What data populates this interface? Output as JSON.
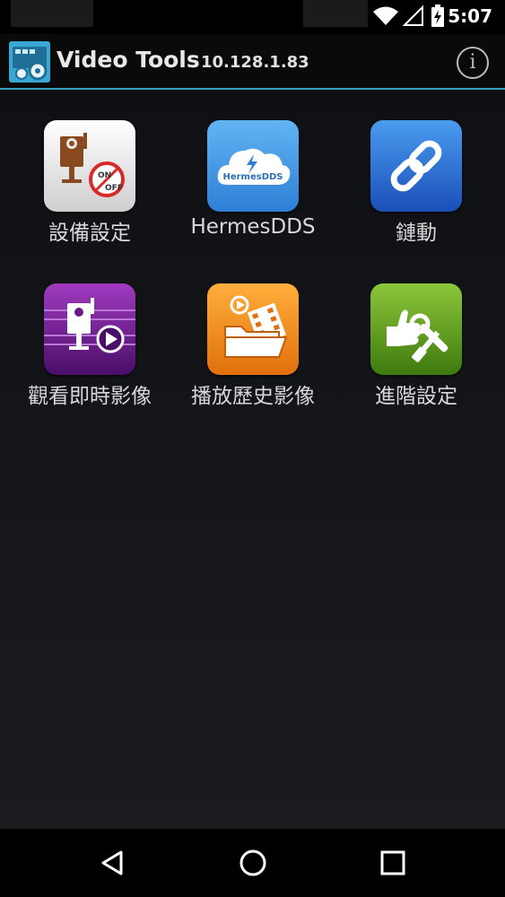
{
  "status_bar": {
    "time": "5:07",
    "icons": [
      "wifi-icon",
      "cell-signal-icon",
      "battery-charging-icon"
    ]
  },
  "action_bar": {
    "title": "Video Tools",
    "ip_address": "10.128.1.83",
    "app_icon": "video-tools-app-icon",
    "info_icon": "info-icon",
    "accent_color": "#2ea4c4"
  },
  "tiles": [
    {
      "label": "設備設定",
      "icon": "camera-on-off-icon",
      "icon_color": "#e8e8e8"
    },
    {
      "label": "HermesDDS",
      "icon": "hermes-dds-cloud-icon",
      "icon_text": "HermesDDS",
      "icon_color": "#3b8fde"
    },
    {
      "label": "鏈動",
      "icon": "link-chain-icon",
      "icon_color": "#2e6fd6"
    },
    {
      "label": "觀看即時影像",
      "icon": "live-camera-play-icon",
      "icon_color": "#6a1a8a"
    },
    {
      "label": "播放歷史影像",
      "icon": "history-video-folder-icon",
      "icon_color": "#f08a1c"
    },
    {
      "label": "進階設定",
      "icon": "advanced-settings-tools-icon",
      "icon_color": "#6aa81c"
    }
  ],
  "nav_bar": {
    "back": "back-icon",
    "home": "home-icon",
    "recents": "recents-icon"
  }
}
